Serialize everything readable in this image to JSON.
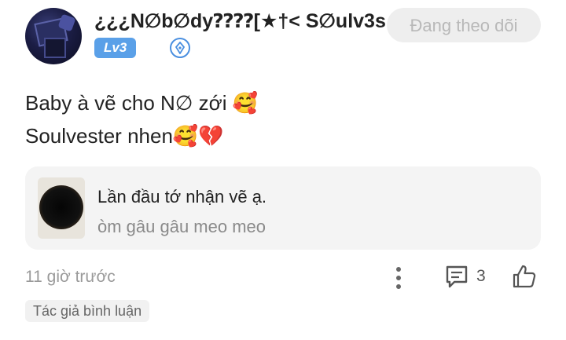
{
  "header": {
    "username": "¿¿¿N∅b∅dy⁇⁇[★†< S∅ulv3s...",
    "level": "Lv3",
    "follow_label": "Đang theo dõi"
  },
  "post": {
    "line1": "Baby à vẽ cho N∅ zới 🥰",
    "line2": "Soulvester nhen🥰💔"
  },
  "quote": {
    "title": "Lần đầu tớ nhận vẽ ạ.",
    "subtitle": "òm gâu gâu meo meo"
  },
  "footer": {
    "timestamp": "11 giờ trước",
    "comment_count": "3"
  },
  "author_badge": "Tác giả bình luận",
  "colors": {
    "level_badge": "#5aa0e8",
    "follow_bg": "#eeeeee",
    "quote_bg": "#f4f4f4"
  },
  "icons": {
    "verify": "verified-badge-icon",
    "more": "more-vertical-icon",
    "comment": "comment-icon",
    "like": "thumbs-up-icon"
  }
}
